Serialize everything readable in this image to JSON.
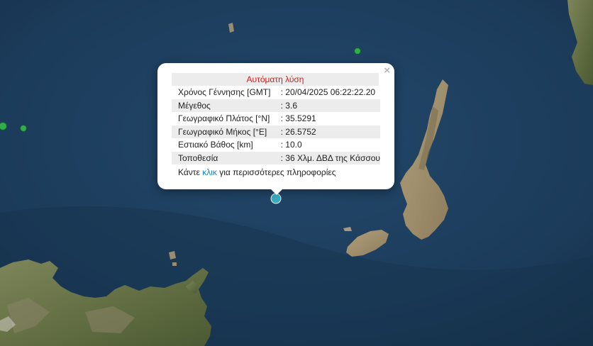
{
  "popup": {
    "title": "Αυτόματη λύση",
    "close_glyph": "×",
    "rows": [
      {
        "label": "Χρόνος Γέννησης [GMT]",
        "value": ": 20/04/2025 06:22:22.20"
      },
      {
        "label": "Μέγεθος",
        "value": ": 3.6"
      },
      {
        "label": "Γεωγραφικό Πλάτος [°N]",
        "value": ": 35.5291"
      },
      {
        "label": "Γεωγραφικό Μήκος [°E]",
        "value": ": 26.5752"
      },
      {
        "label": "Εστιακό Βάθος [km]",
        "value": ": 10.0"
      },
      {
        "label": "Τοποθεσία",
        "value": ": 36 Χλμ. ΔΒΔ της Κάσσου"
      }
    ],
    "more_prefix": "Κάντε ",
    "more_link": "κλικ",
    "more_suffix": " για περισσότερες πληροφορίες"
  },
  "markers": {
    "selected_color": "#3bb3c8",
    "other_color": "#2fae4b"
  },
  "colors": {
    "sea": "#1d3a57",
    "land": "#6f7a4c",
    "land_light": "#a39476"
  }
}
